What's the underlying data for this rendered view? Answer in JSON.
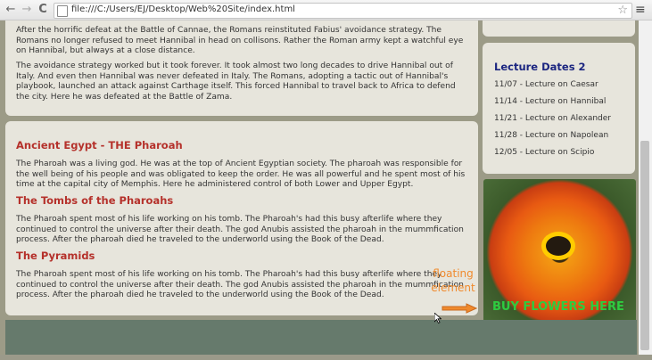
{
  "browser": {
    "url": "file:///C:/Users/EJ/Desktop/Web%20Site/index.html",
    "back": "←",
    "forward": "→",
    "reload": "C",
    "star": "☆",
    "menu": "≡"
  },
  "main": {
    "rome_p1": "After the horrific defeat at the Battle of Cannae, the Romans reinstituted Fabius' avoidance strategy. The Romans no longer refused to meet Hannibal in head on collisons. Rather the Roman army kept a watchful eye on Hannibal, but always at a close distance.",
    "rome_p2": "The avoidance strategy worked but it took forever. It took almost two long decades to drive Hannibal out of Italy. And even then Hannibal was never defeated in Italy. The Romans, adopting a tactic out of Hannibal's playbook, launched an attack against Carthage itself. This forced Hannibal to travel back to Africa to defend the city. Here he was defeated at the Battle of Zama.",
    "egypt_title": "Ancient Egypt - THE Pharoah",
    "egypt_text": "The Pharoah was a living god. He was at the top of Ancient Egyptian society. The pharoah was responsible for the well being of his people and was obligated to keep the order. He was all powerful and he spent most of his time at the capital city of Memphis. Here he administered control of both Lower and Upper Egypt.",
    "tombs_title": "The Tombs of the Pharoahs",
    "tombs_text": "The Pharoah spent most of his life working on his tomb. The Pharoah's had this busy afterlife where they continued to control the universe after their death. The god Anubis assisted the pharoah in the mummfication process. After the pharoah died he traveled to the underworld using the Book of the Dead.",
    "pyramids_title": "The Pyramids",
    "pyramids_text": "The Pharoah spent most of his life working on his tomb. The Pharoah's had this busy afterlife where they continued to control the universe after their death. The god Anubis assisted the pharoah in the mummfication process. After the pharoah died he traveled to the underworld using the Book of the Dead."
  },
  "sidebar": {
    "title": "Lecture Dates 2",
    "lectures": [
      "11/07 - Lecture on Caesar",
      "11/14 - Lecture on Hannibal",
      "11/21 - Lecture on Alexander",
      "11/28 - Lecture on Napolean",
      "12/05 - Lecture on Scipio"
    ]
  },
  "annotation": {
    "floating_line1": "floating",
    "floating_line2": "element",
    "buy": "BUY FLOWERS HERE"
  },
  "colors": {
    "heading_red": "#b5312b",
    "sidebar_title_blue": "#1c2680",
    "buy_green": "#2ecc40",
    "annotation_orange": "#f08a2d"
  }
}
